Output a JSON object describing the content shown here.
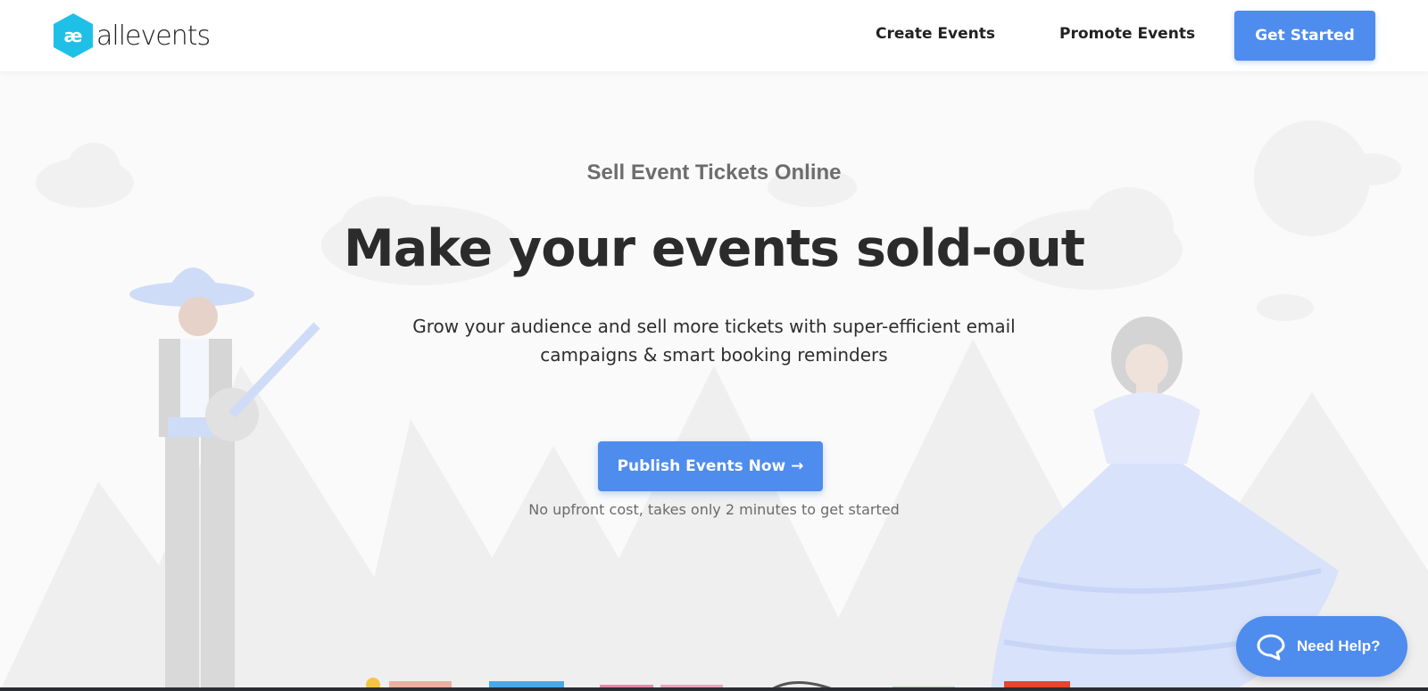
{
  "header": {
    "logo_text": "allevents",
    "logo_icon": "ae-hexagon-logo",
    "nav": {
      "create_events": "Create Events",
      "promote_events": "Promote Events"
    },
    "cta_label": "Get Started"
  },
  "hero": {
    "eyebrow": "Sell Event Tickets Online",
    "headline": "Make your events sold-out",
    "subtitle": "Grow your audience and sell more tickets with super-efficient email campaigns & smart booking reminders",
    "cta_label": "Publish Events Now →",
    "note": "No upfront cost, takes only 2 minutes to get started"
  },
  "help": {
    "label": "Need Help?",
    "icon": "chat-bubble-icon"
  },
  "colors": {
    "accent": "#4e8ced",
    "illustration_blue": "#d6e0fb",
    "illustration_gray": "#e6e6e6"
  }
}
